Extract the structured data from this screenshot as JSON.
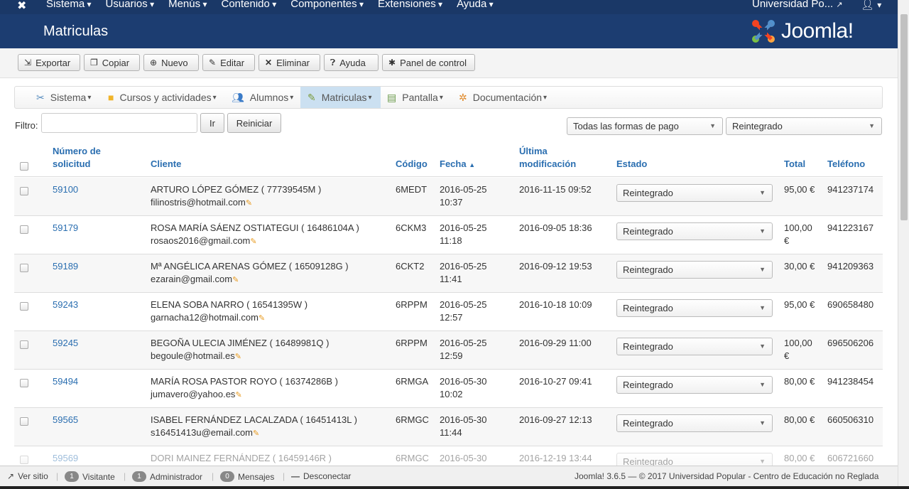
{
  "topnav": {
    "menus": [
      "Sistema",
      "Usuarios",
      "Menús",
      "Contenido",
      "Componentes",
      "Extensiones",
      "Ayuda"
    ],
    "site": "Universidad Po...",
    "user_icon": "user-icon"
  },
  "header": {
    "title": "Matriculas",
    "logo_text": "Joomla!"
  },
  "toolbar": {
    "export": "Exportar",
    "copy": "Copiar",
    "new": "Nuevo",
    "edit": "Editar",
    "delete": "Eliminar",
    "help": "Ayuda",
    "control_panel": "Panel de control"
  },
  "submenu": {
    "items": [
      "Sistema",
      "Cursos y actividades",
      "Alumnos",
      "Matriculas",
      "Pantalla",
      "Documentación"
    ]
  },
  "filter": {
    "label": "Filtro:",
    "value": "",
    "go": "Ir",
    "reset": "Reiniciar",
    "payment": "Todas las formas de pago",
    "status": "Reintegrado"
  },
  "table": {
    "headers": {
      "number_1": "Número de",
      "number_2": "solicitud",
      "client": "Cliente",
      "code": "Código",
      "date": "Fecha",
      "modified_1": "Última",
      "modified_2": "modificación",
      "status": "Estado",
      "total": "Total",
      "phone": "Teléfono"
    },
    "rows": [
      {
        "num": "59100",
        "client": "ARTURO LÓPEZ GÓMEZ ( 77739545M )",
        "email": "filinostris@hotmail.com",
        "code": "6MEDT",
        "date": "2016-05-25",
        "time": "10:37",
        "modified": "2016-11-15 09:52",
        "status": "Reintegrado",
        "total": "95,00 €",
        "total2": "",
        "phone": "941237174"
      },
      {
        "num": "59179",
        "client": "ROSA MARÍA SÁENZ OSTIATEGUI ( 16486104A )",
        "email": "rosaos2016@gmail.com",
        "code": "6CKM3",
        "date": "2016-05-25",
        "time": "11:18",
        "modified": "2016-09-05 18:36",
        "status": "Reintegrado",
        "total": "100,00",
        "total2": "€",
        "phone": "941223167"
      },
      {
        "num": "59189",
        "client": "Mª ANGÉLICA ARENAS GÓMEZ ( 16509128G )",
        "email": "ezarain@gmail.com",
        "code": "6CKT2",
        "date": "2016-05-25",
        "time": "11:41",
        "modified": "2016-09-12 19:53",
        "status": "Reintegrado",
        "total": "30,00 €",
        "total2": "",
        "phone": "941209363"
      },
      {
        "num": "59243",
        "client": "ELENA SOBA NARRO ( 16541395W )",
        "email": "garnacha12@hotmail.com",
        "code": "6RPPM",
        "date": "2016-05-25",
        "time": "12:57",
        "modified": "2016-10-18 10:09",
        "status": "Reintegrado",
        "total": "95,00 €",
        "total2": "",
        "phone": "690658480"
      },
      {
        "num": "59245",
        "client": "BEGOÑA ULECIA JIMÉNEZ ( 16489981Q )",
        "email": "begoule@hotmail.es",
        "code": "6RPPM",
        "date": "2016-05-25",
        "time": "12:59",
        "modified": "2016-09-29 11:00",
        "status": "Reintegrado",
        "total": "100,00",
        "total2": "€",
        "phone": "696506206"
      },
      {
        "num": "59494",
        "client": "MARÍA ROSA PASTOR ROYO ( 16374286B )",
        "email": "jumavero@yahoo.es",
        "code": "6RMGA",
        "date": "2016-05-30",
        "time": "10:02",
        "modified": "2016-10-27 09:41",
        "status": "Reintegrado",
        "total": "80,00 €",
        "total2": "",
        "phone": "941238454"
      },
      {
        "num": "59565",
        "client": "ISABEL FERNÁNDEZ LACALZADA ( 16451413L )",
        "email": "s16451413u@email.com",
        "code": "6RMGC",
        "date": "2016-05-30",
        "time": "11:44",
        "modified": "2016-09-27 12:13",
        "status": "Reintegrado",
        "total": "80,00 €",
        "total2": "",
        "phone": "660506310"
      },
      {
        "num": "59569",
        "client": "DORI MAINEZ FERNÁNDEZ ( 16459146R )",
        "email": "",
        "code": "6RMGC",
        "date": "2016-05-30",
        "time": "",
        "modified": "2016-12-19 13:44",
        "status": "Reintegrado",
        "total": "80,00 €",
        "total2": "",
        "phone": "606721660"
      }
    ]
  },
  "footer": {
    "view_site": "Ver sitio",
    "visitors_count": "1",
    "visitors": "Visitante",
    "admins_count": "1",
    "admins": "Administrador",
    "messages_count": "0",
    "messages": "Mensajes",
    "logout": "Desconectar",
    "version": "Joomla! 3.6.5",
    "copyright": "— © 2017 Universidad Popular - Centro de Educación no Reglada"
  }
}
